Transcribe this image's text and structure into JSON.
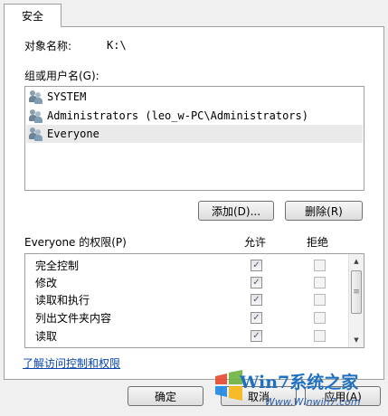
{
  "tab": {
    "label": "安全"
  },
  "object": {
    "label": "对象名称:",
    "value": "K:\\"
  },
  "group_label": "组或用户名(G):",
  "users": [
    {
      "name": "SYSTEM",
      "selected": false
    },
    {
      "name": "Administrators (leo_w-PC\\Administrators)",
      "selected": false
    },
    {
      "name": "Everyone",
      "selected": true
    }
  ],
  "buttons": {
    "add": "添加(D)...",
    "remove": "删除(R)",
    "ok": "确定",
    "cancel": "取消",
    "apply": "应用(A)"
  },
  "permissions": {
    "header": "Everyone 的权限(P)",
    "allow_label": "允许",
    "deny_label": "拒绝",
    "rows": [
      {
        "name": "完全控制",
        "allow": true,
        "deny": false
      },
      {
        "name": "修改",
        "allow": true,
        "deny": false
      },
      {
        "name": "读取和执行",
        "allow": true,
        "deny": false
      },
      {
        "name": "列出文件夹内容",
        "allow": true,
        "deny": false
      },
      {
        "name": "读取",
        "allow": true,
        "deny": false
      }
    ]
  },
  "link": "了解访问控制和权限",
  "watermark": {
    "brand": "Win7系统之家",
    "url": "Www.Winwin7.com"
  }
}
